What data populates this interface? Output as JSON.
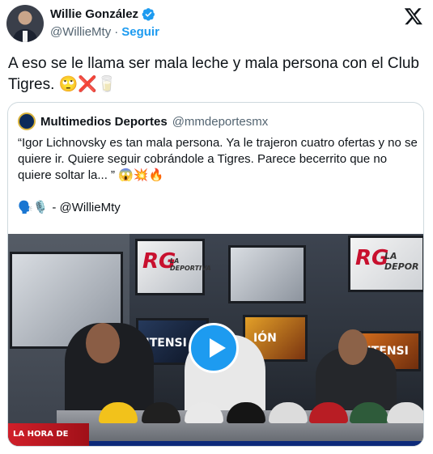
{
  "author": {
    "name": "Willie González",
    "handle": "@WillieMty",
    "separator": "·",
    "follow_label": "Seguir",
    "verified_icon": "verified-badge-icon",
    "brand_icon": "x-logo-icon"
  },
  "tweet": {
    "text": "A eso se le llama ser mala leche y mala persona con el Club Tigres.",
    "emojis": "🙄❌🥛"
  },
  "quote": {
    "name": "Multimedios Deportes",
    "handle": "@mmdeportesmx",
    "text": "“Igor Lichnovsky es tan mala persona. Ya le trajeron cuatro ofertas y no se quiere ir. Quiere seguir cobrándole a Tigres. Parece becerrito que no quiere soltar la... ”",
    "text_emojis": "😱💥🔥",
    "signature_emojis": "🗣️🎙️",
    "signature_text": "- @WillieMty"
  },
  "video": {
    "logo_left": "RG",
    "logo_left_sub": "LA DEPORTIVA",
    "logo_right": "RG",
    "logo_right_sub": "LA DEPOR",
    "wall_left": "NTENSI",
    "wall_mid": "IÓN",
    "wall_right": "NTENSI",
    "banner": "LA HORA DE",
    "play_icon": "play-icon"
  },
  "colors": {
    "accent": "#1d9bf0",
    "secondary_text": "#536471",
    "border": "#cfd9de"
  }
}
